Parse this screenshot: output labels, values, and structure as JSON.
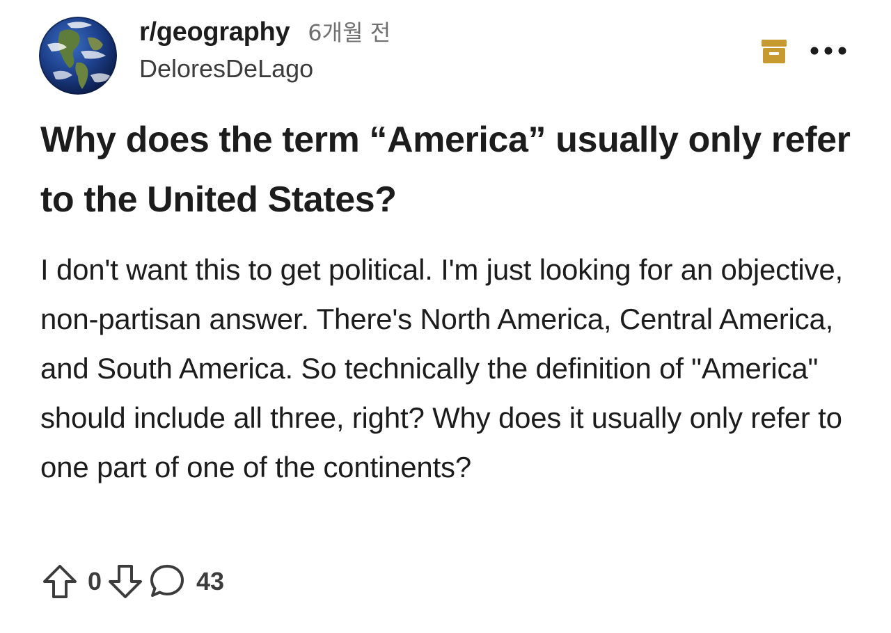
{
  "post": {
    "subreddit": "r/geography",
    "time_ago": "6개월 전",
    "author": "DeloresDeLago",
    "title": "Why does the term “America” usually only refer to the United States?",
    "body": "I don't want this to get political. I'm just looking for an objective, non-partisan answer. There's North America, Central America, and South America. So technically the definition of \"America\" should include all three, right? Why does it usually only refer to one part of one of the continents?",
    "score": "0",
    "comment_count": "43"
  },
  "icons": {
    "avatar": "globe-avatar",
    "save": "archive-box-icon",
    "more": "more-dots-icon",
    "upvote": "upvote-arrow-icon",
    "downvote": "downvote-arrow-icon",
    "comments": "comment-bubble-icon"
  },
  "colors": {
    "accent_gold": "#c69a2f",
    "text_primary": "#1c1c1c",
    "text_muted": "#6f6f6f"
  }
}
